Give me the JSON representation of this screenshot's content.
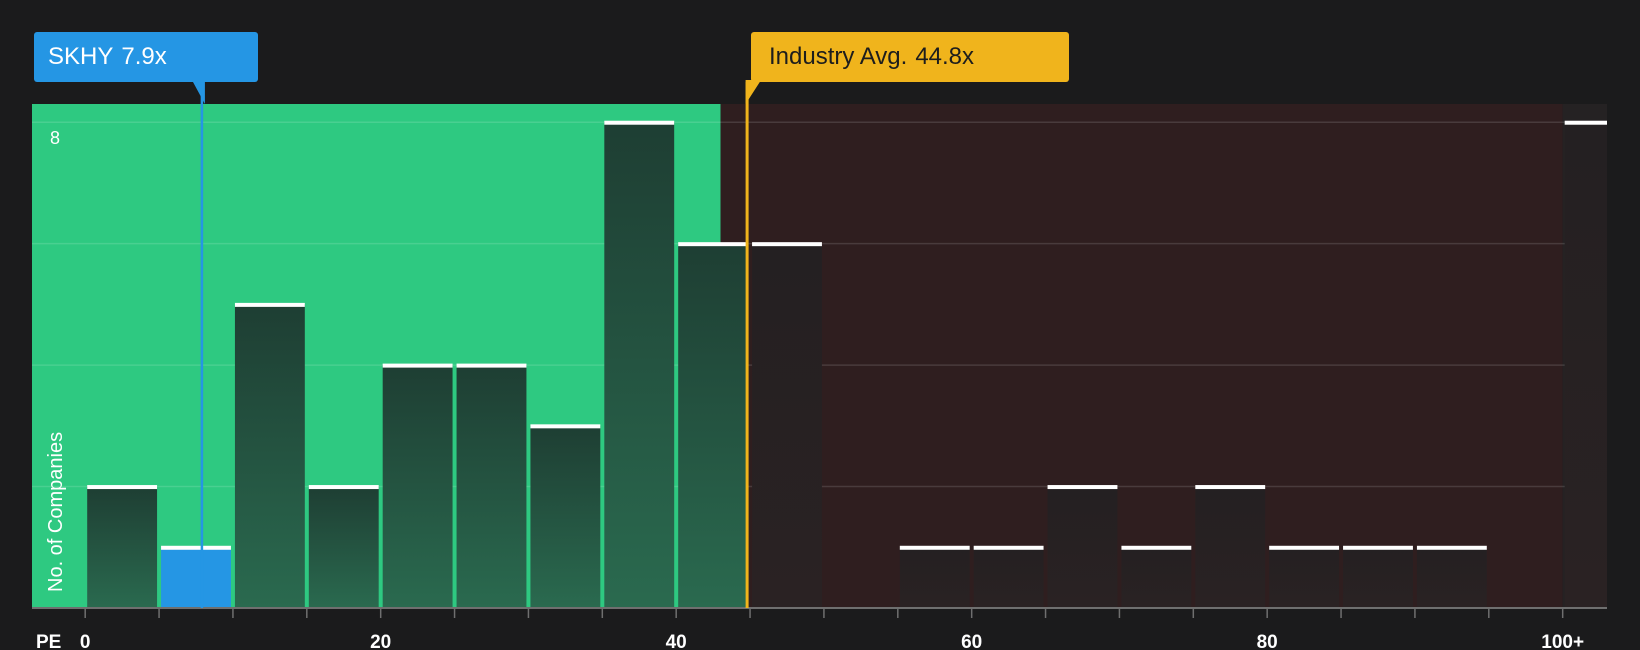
{
  "chart_data": {
    "type": "bar",
    "xlabel": "PE",
    "ylabel": "No. of Companies",
    "x_ticks": [
      "0",
      "20",
      "40",
      "60",
      "80",
      "100+"
    ],
    "x_tick_values": [
      0,
      20,
      40,
      60,
      80,
      100
    ],
    "y_tick_label": "8",
    "y_tick_value": 8,
    "xlim": [
      -3.6,
      103
    ],
    "ylim": [
      0,
      8.3
    ],
    "bin_width": 5,
    "bins_start": [
      0,
      5,
      10,
      15,
      20,
      25,
      30,
      35,
      40,
      45,
      50,
      55,
      60,
      65,
      70,
      75,
      80,
      85,
      90,
      95,
      100
    ],
    "values": [
      2,
      1,
      5,
      2,
      4,
      4,
      3,
      8,
      6,
      6,
      0,
      1,
      1,
      2,
      1,
      2,
      1,
      1,
      1,
      0,
      8
    ],
    "company": {
      "name": "SKHY",
      "value_label": "7.9x",
      "value": 7.9
    },
    "industry": {
      "name": "Industry Avg.",
      "value_label": "44.8x",
      "value": 44.8
    },
    "fair_zone_end": 43
  },
  "colors": {
    "background": "#1b1b1c",
    "green_zone": "#2ec981",
    "red_zone": "#2f1e1f",
    "company": "#2596e4",
    "industry": "#f0b41c",
    "bar_cap": "#ffffff"
  }
}
